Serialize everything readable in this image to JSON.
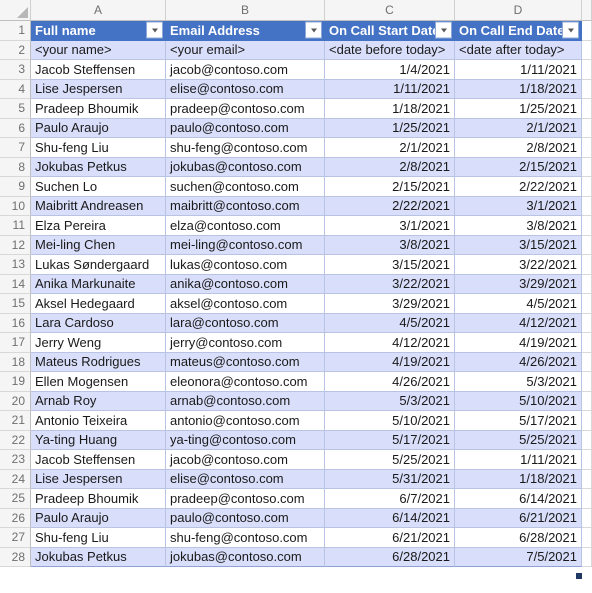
{
  "app": {
    "type": "spreadsheet",
    "select_all_icon": "select-all-triangle",
    "filter_icon": "filter-dropdown-icon",
    "resize_icon": "table-resize-handle"
  },
  "colors": {
    "header_fill": "#4472C4",
    "header_text": "#FFFFFF",
    "band_fill": "#D9DEFA",
    "base_fill": "#FFFFFF",
    "table_border": "#B9C3E3",
    "gutter_fill": "#F5F5F5",
    "gutter_text": "#6F6F6F",
    "resize_handle": "#1F3864"
  },
  "column_letters": [
    "A",
    "B",
    "C",
    "D"
  ],
  "row_numbers": [
    "1",
    "2",
    "3",
    "4",
    "5",
    "6",
    "7",
    "8",
    "9",
    "10",
    "11",
    "12",
    "13",
    "14",
    "15",
    "16",
    "17",
    "18",
    "19",
    "20",
    "21",
    "22",
    "23",
    "24",
    "25",
    "26",
    "27",
    "28"
  ],
  "table": {
    "headers": [
      "Full name",
      "Email Address",
      "On Call Start Date",
      "On Call End Date"
    ],
    "alignments": [
      "left",
      "left",
      "right",
      "right"
    ],
    "instruction_row": [
      "<your name>",
      "<your email>",
      "<date before today>",
      "<date after today>"
    ],
    "rows": [
      [
        "Jacob Steffensen",
        "jacob@contoso.com",
        "1/4/2021",
        "1/11/2021"
      ],
      [
        "Lise Jespersen",
        "elise@contoso.com",
        "1/11/2021",
        "1/18/2021"
      ],
      [
        "Pradeep Bhoumik",
        "pradeep@contoso.com",
        "1/18/2021",
        "1/25/2021"
      ],
      [
        "Paulo Araujo",
        "paulo@contoso.com",
        "1/25/2021",
        "2/1/2021"
      ],
      [
        "Shu-feng Liu",
        "shu-feng@contoso.com",
        "2/1/2021",
        "2/8/2021"
      ],
      [
        "Jokubas Petkus",
        "jokubas@contoso.com",
        "2/8/2021",
        "2/15/2021"
      ],
      [
        "Suchen Lo",
        "suchen@contoso.com",
        "2/15/2021",
        "2/22/2021"
      ],
      [
        "Maibritt Andreasen",
        "maibritt@contoso.com",
        "2/22/2021",
        "3/1/2021"
      ],
      [
        "Elza Pereira",
        "elza@contoso.com",
        "3/1/2021",
        "3/8/2021"
      ],
      [
        "Mei-ling Chen",
        "mei-ling@contoso.com",
        "3/8/2021",
        "3/15/2021"
      ],
      [
        "Lukas Søndergaard",
        "lukas@contoso.com",
        "3/15/2021",
        "3/22/2021"
      ],
      [
        "Anika Markunaite",
        "anika@contoso.com",
        "3/22/2021",
        "3/29/2021"
      ],
      [
        "Aksel Hedegaard",
        "aksel@contoso.com",
        "3/29/2021",
        "4/5/2021"
      ],
      [
        "Lara Cardoso",
        "lara@contoso.com",
        "4/5/2021",
        "4/12/2021"
      ],
      [
        "Jerry Weng",
        "jerry@contoso.com",
        "4/12/2021",
        "4/19/2021"
      ],
      [
        "Mateus Rodrigues",
        "mateus@contoso.com",
        "4/19/2021",
        "4/26/2021"
      ],
      [
        "Ellen Mogensen",
        "eleonora@contoso.com",
        "4/26/2021",
        "5/3/2021"
      ],
      [
        "Arnab Roy",
        "arnab@contoso.com",
        "5/3/2021",
        "5/10/2021"
      ],
      [
        "Antonio Teixeira",
        "antonio@contoso.com",
        "5/10/2021",
        "5/17/2021"
      ],
      [
        "Ya-ting Huang",
        "ya-ting@contoso.com",
        "5/17/2021",
        "5/25/2021"
      ],
      [
        "Jacob Steffensen",
        "jacob@contoso.com",
        "5/25/2021",
        "1/11/2021"
      ],
      [
        "Lise Jespersen",
        "elise@contoso.com",
        "5/31/2021",
        "1/18/2021"
      ],
      [
        "Pradeep Bhoumik",
        "pradeep@contoso.com",
        "6/7/2021",
        "6/14/2021"
      ],
      [
        "Paulo Araujo",
        "paulo@contoso.com",
        "6/14/2021",
        "6/21/2021"
      ],
      [
        "Shu-feng Liu",
        "shu-feng@contoso.com",
        "6/21/2021",
        "6/28/2021"
      ],
      [
        "Jokubas Petkus",
        "jokubas@contoso.com",
        "6/28/2021",
        "7/5/2021"
      ]
    ]
  }
}
